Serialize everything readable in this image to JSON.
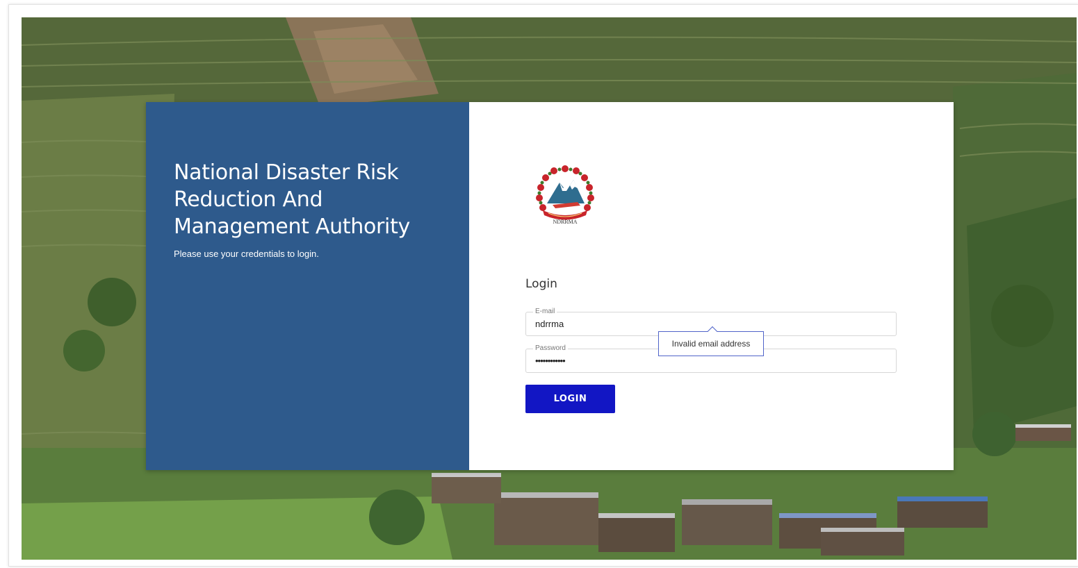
{
  "org": {
    "name": "National Disaster Risk Reduction And Management Authority",
    "subtitle": "Please use your credentials to login."
  },
  "logo": {
    "caption": "NDRRMA",
    "icon": "nepal-government-emblem-icon"
  },
  "login": {
    "heading": "Login",
    "email_label": "E-mail",
    "email_value": "ndrrma",
    "password_label": "Password",
    "password_value": "••••••••••••",
    "button_label": "LOGIN",
    "error_tooltip": "Invalid email address"
  },
  "colors": {
    "left_panel": "#2e5a8c",
    "button": "#1216c4",
    "tooltip_border": "#4f63c9"
  },
  "background": {
    "icon": "hillside-village-photo"
  }
}
